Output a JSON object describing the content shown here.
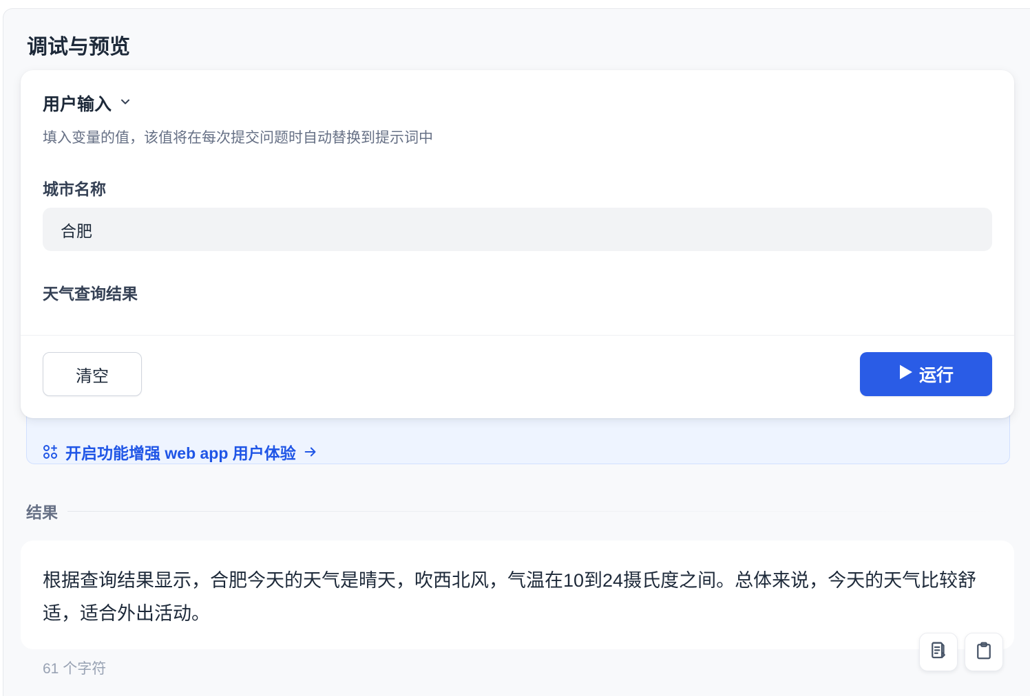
{
  "panel": {
    "title": "调试与预览"
  },
  "user_input": {
    "section_label": "用户输入",
    "hint": "填入变量的值，该值将在每次提交问题时自动替换到提示词中",
    "variables": [
      {
        "label": "城市名称",
        "value": "合肥"
      },
      {
        "label": "天气查询结果",
        "value": ""
      }
    ],
    "clear_label": "清空",
    "run_label": "运行"
  },
  "banner": {
    "link_text": "开启功能增强 web app 用户体验"
  },
  "result": {
    "title": "结果",
    "text": "根据查询结果显示，合肥今天的天气是晴天，吹西北风，气温在10到24摄氏度之间。总体来说，今天的天气比较舒适，适合外出活动。",
    "char_count": "61 个字符"
  },
  "colors": {
    "primary": "#2a5ce6",
    "link": "#1f55e6",
    "banner_bg": "#eef4ff"
  },
  "icons": [
    "chevron-down-icon",
    "play-icon",
    "apps-plus-icon",
    "arrow-right-icon",
    "document-icon",
    "clipboard-icon"
  ]
}
